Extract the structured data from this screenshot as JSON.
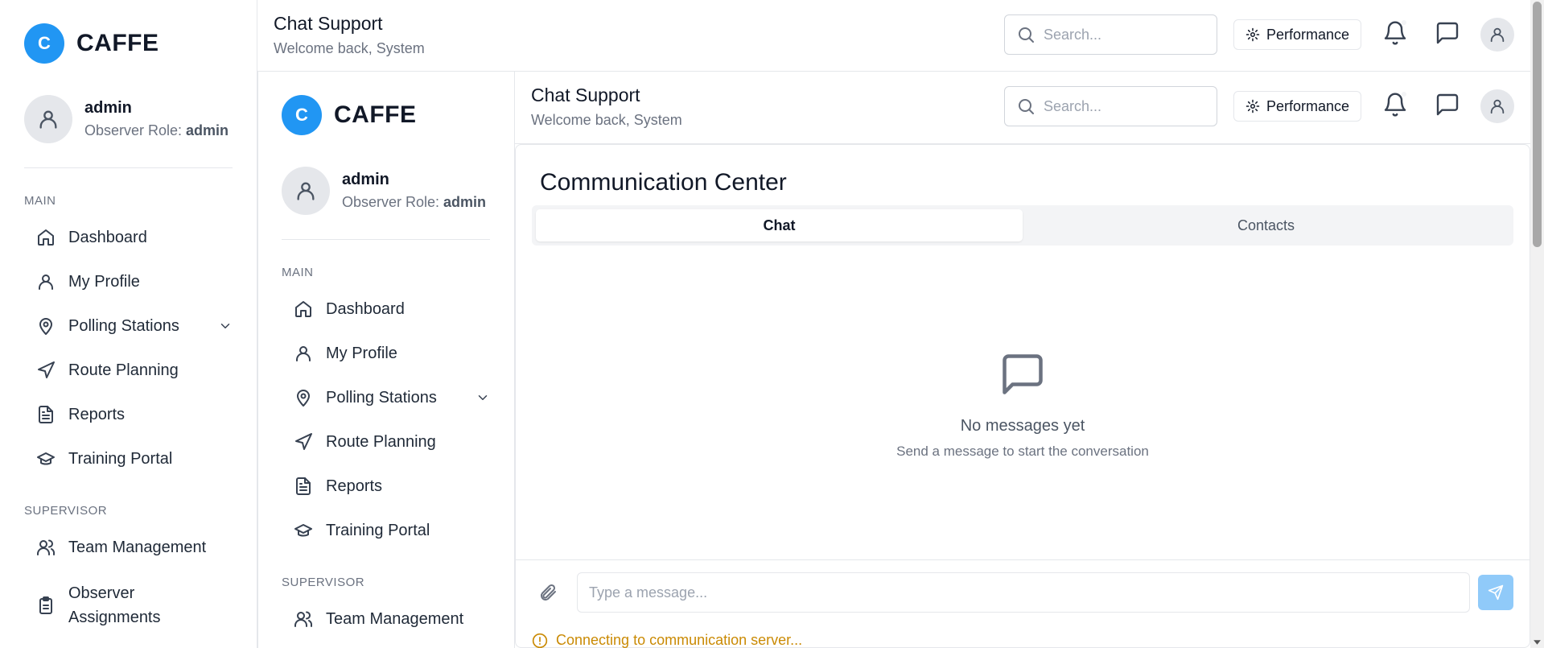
{
  "app": {
    "logo_letter": "C",
    "name": "CAFFE"
  },
  "user": {
    "name": "admin",
    "role_prefix": "Observer Role: ",
    "role": "admin"
  },
  "sidebar": {
    "sections": [
      {
        "label": "MAIN"
      },
      {
        "label": "SUPERVISOR"
      }
    ],
    "items": [
      {
        "label": "Dashboard",
        "icon": "home-icon"
      },
      {
        "label": "My Profile",
        "icon": "user-icon"
      },
      {
        "label": "Polling Stations",
        "icon": "map-pin-icon",
        "expandable": true
      },
      {
        "label": "Route Planning",
        "icon": "navigation-icon"
      },
      {
        "label": "Reports",
        "icon": "file-text-icon"
      },
      {
        "label": "Training Portal",
        "icon": "graduation-cap-icon"
      },
      {
        "label": "Team Management",
        "icon": "users-icon"
      },
      {
        "label": "Observer Assignments",
        "icon": "clipboard-icon"
      }
    ]
  },
  "header": {
    "title": "Chat Support",
    "subtitle": "Welcome back, System",
    "search_placeholder": "Search...",
    "performance_label": "Performance"
  },
  "main": {
    "title": "Communication Center",
    "tabs": [
      {
        "label": "Chat",
        "active": true
      },
      {
        "label": "Contacts",
        "active": false
      }
    ],
    "empty_title": "No messages yet",
    "empty_subtitle": "Send a message to start the conversation",
    "message_placeholder": "Type a message...",
    "status_text": "Connecting to communication server..."
  },
  "colors": {
    "brand": "#2196f3",
    "send_button": "#90caf9",
    "warning": "#ca8a04"
  }
}
